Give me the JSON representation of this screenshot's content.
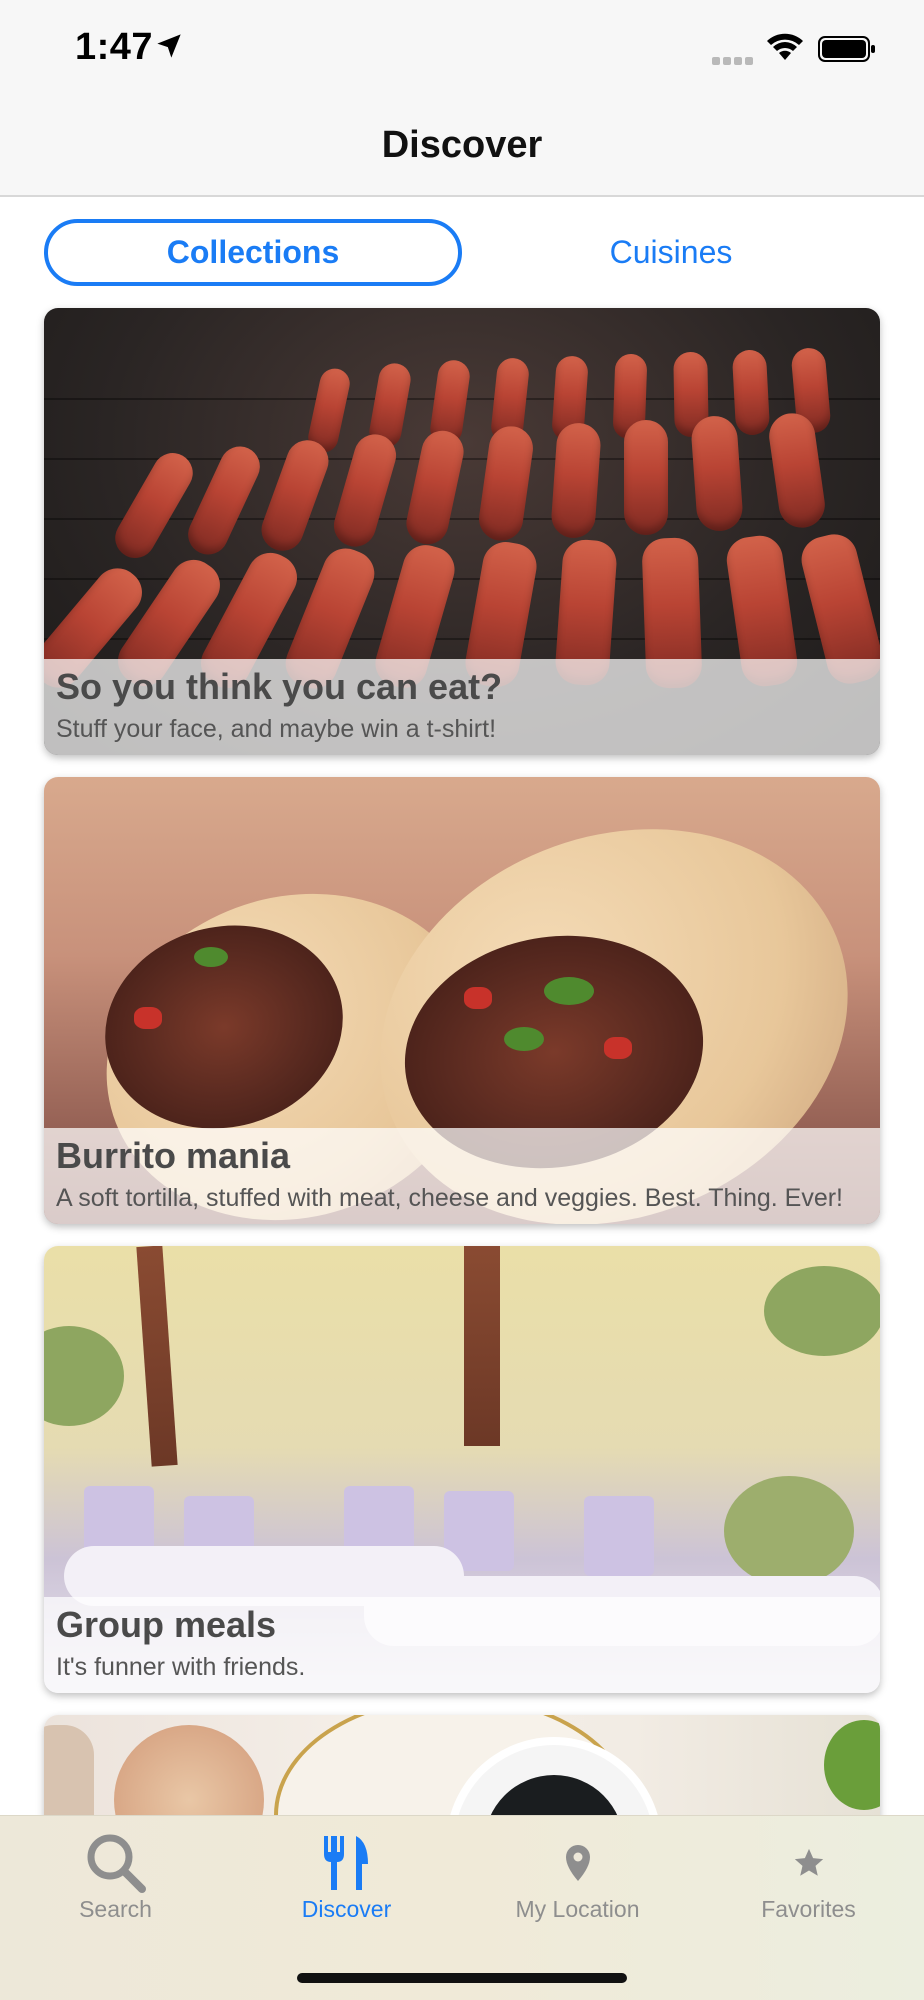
{
  "status_bar": {
    "time": "1:47"
  },
  "nav": {
    "title": "Discover"
  },
  "segments": {
    "items": [
      {
        "label": "Collections",
        "selected": true
      },
      {
        "label": "Cuisines",
        "selected": false
      }
    ]
  },
  "collections": [
    {
      "title": "So you think you can eat?",
      "subtitle": "Stuff your face, and maybe win a t-shirt!"
    },
    {
      "title": "Burrito mania",
      "subtitle": "A soft tortilla, stuffed with meat, cheese and veggies. Best. Thing. Ever!"
    },
    {
      "title": "Group meals",
      "subtitle": "It's funner with friends."
    }
  ],
  "tab_bar": {
    "items": [
      {
        "label": "Search",
        "icon": "search-icon",
        "selected": false
      },
      {
        "label": "Discover",
        "icon": "fork-knife-icon",
        "selected": true
      },
      {
        "label": "My Location",
        "icon": "location-pin-icon",
        "selected": false
      },
      {
        "label": "Favorites",
        "icon": "star-icon",
        "selected": false
      }
    ]
  },
  "colors": {
    "accent": "#1a7cf5",
    "inactive_tab": "#8e8e8e"
  }
}
